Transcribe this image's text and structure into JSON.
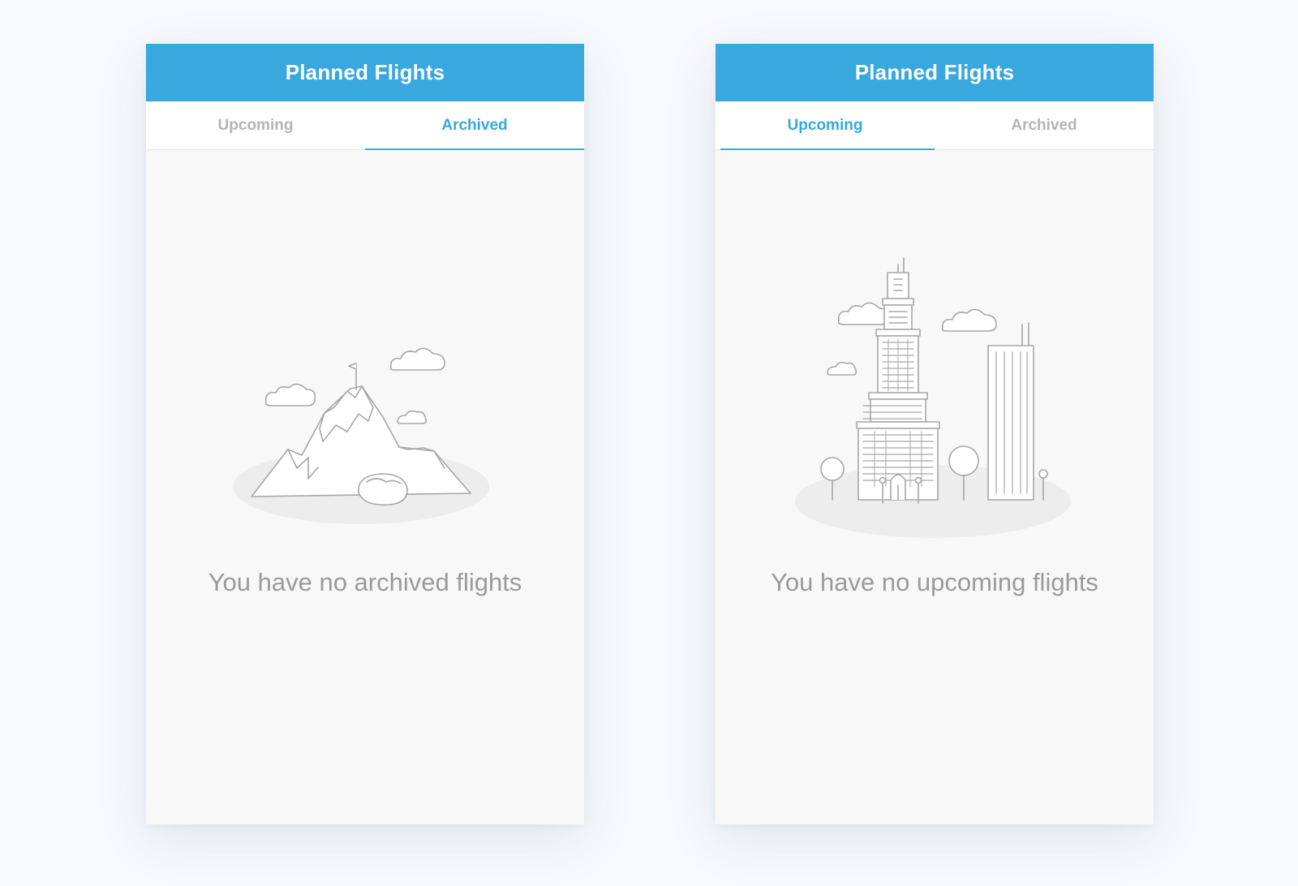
{
  "screens": [
    {
      "header": {
        "title": "Planned Flights"
      },
      "tabs": [
        {
          "label": "Upcoming",
          "active": false
        },
        {
          "label": "Archived",
          "active": true
        }
      ],
      "illustration": "mountain-illustration",
      "empty_message": "You have no archived flights"
    },
    {
      "header": {
        "title": "Planned Flights"
      },
      "tabs": [
        {
          "label": "Upcoming",
          "active": true
        },
        {
          "label": "Archived",
          "active": false
        }
      ],
      "illustration": "city-skyline-illustration",
      "empty_message": "You have no upcoming flights"
    }
  ],
  "colors": {
    "accent": "#38a8df",
    "inactive_tab": "#b4b4b4",
    "message": "#9a9a9a",
    "panel_background": "#f8f8f8"
  }
}
